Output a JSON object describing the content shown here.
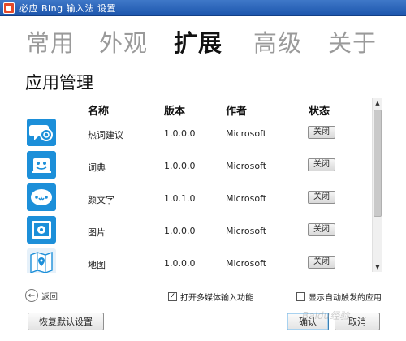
{
  "window": {
    "title": "必应 Bing 输入法 设置"
  },
  "tabs": [
    {
      "label": "常用",
      "active": false
    },
    {
      "label": "外观",
      "active": false
    },
    {
      "label": "扩展",
      "active": true
    },
    {
      "label": "高级",
      "active": false
    },
    {
      "label": "关于",
      "active": false
    }
  ],
  "section": {
    "title": "应用管理"
  },
  "table": {
    "headers": {
      "name": "名称",
      "version": "版本",
      "author": "作者",
      "status": "状态"
    },
    "rows": [
      {
        "icon": "chat-bubble-search-icon",
        "name": "热词建议",
        "version": "1.0.0.0",
        "author": "Microsoft",
        "status_button": "关闭"
      },
      {
        "icon": "dictionary-book-icon",
        "name": "词典",
        "version": "1.0.0.0",
        "author": "Microsoft",
        "status_button": "关闭"
      },
      {
        "icon": "emoticon-face-icon",
        "name": "颜文字",
        "version": "1.0.1.0",
        "author": "Microsoft",
        "status_button": "关闭"
      },
      {
        "icon": "image-frame-icon",
        "name": "图片",
        "version": "1.0.0.0",
        "author": "Microsoft",
        "status_button": "关闭"
      },
      {
        "icon": "map-pin-icon",
        "name": "地图",
        "version": "1.0.0.0",
        "author": "Microsoft",
        "status_button": "关闭"
      }
    ]
  },
  "back": {
    "label": "返回"
  },
  "options": {
    "multimedia": {
      "label": "打开多媒体输入功能",
      "checked": true
    },
    "auto_trigger": {
      "label": "显示自动触发的应用",
      "checked": false
    }
  },
  "buttons": {
    "reset": "恢复默认设置",
    "ok": "确认",
    "cancel": "取消"
  },
  "watermark": "Baidu经验",
  "colors": {
    "titlebar": "#1d56ad",
    "icon_blue": "#1c8fd9",
    "active_tab": "#111111",
    "inactive_tab": "#9a9a9a"
  }
}
